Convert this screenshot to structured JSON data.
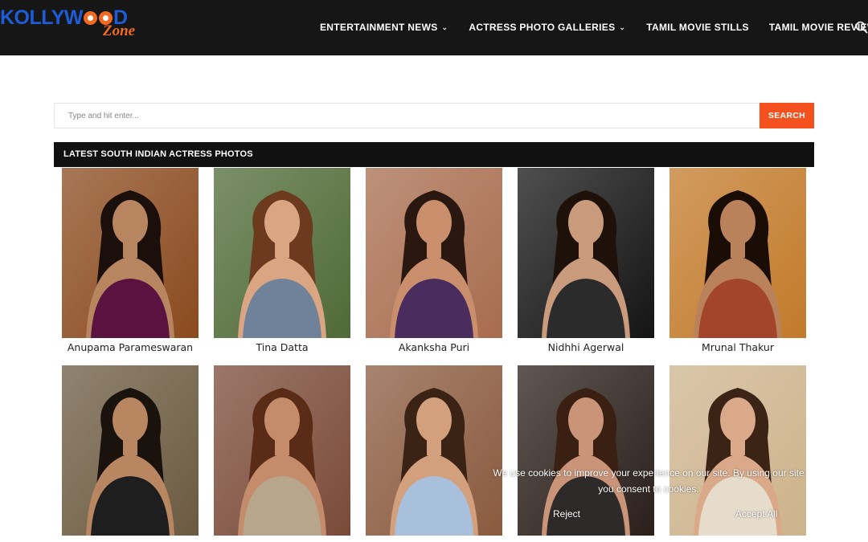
{
  "header": {
    "logo_main_a": "KOLLYW",
    "logo_main_b": "D",
    "logo_sub": "Zone",
    "nav": [
      {
        "label": "ENTERTAINMENT NEWS",
        "has_dropdown": true
      },
      {
        "label": "ACTRESS PHOTO GALLERIES",
        "has_dropdown": true
      },
      {
        "label": "TAMIL MOVIE STILLS",
        "has_dropdown": false
      },
      {
        "label": "TAMIL MOVIE REVIEWS",
        "has_dropdown": false
      }
    ],
    "search_icon": "search-icon"
  },
  "search": {
    "placeholder": "Type and hit enter...",
    "button_label": "SEARCH"
  },
  "section": {
    "title": "LATEST SOUTH INDIAN ACTRESS PHOTOS"
  },
  "gallery": [
    {
      "name": "Anupama Parameswaran",
      "bg": "#8a4a1e",
      "outfit": "#5a1240",
      "hair": "#1a0f0a",
      "skin": "#b7855f"
    },
    {
      "name": "Tina Datta",
      "bg": "#4f6a36",
      "outfit": "#6f8299",
      "hair": "#6b3a1f",
      "skin": "#d9a582"
    },
    {
      "name": "Akanksha Puri",
      "bg": "#a86c4e",
      "outfit": "#4a2d5e",
      "hair": "#2a1810",
      "skin": "#c98e6c"
    },
    {
      "name": "Nidhhi Agerwal",
      "bg": "#141414",
      "outfit": "#2b2b2b",
      "hair": "#1d1109",
      "skin": "#c99a7c"
    },
    {
      "name": "Mrunal Thakur",
      "bg": "#c27a2a",
      "outfit": "#a3452a",
      "hair": "#1a0d06",
      "skin": "#b9825b"
    },
    {
      "name": "",
      "bg": "#6b5a40",
      "outfit": "#1e1e1e",
      "hair": "#1a120c",
      "skin": "#b88660"
    },
    {
      "name": "",
      "bg": "#7a4a38",
      "outfit": "#b7a58c",
      "hair": "#5a2c18",
      "skin": "#c48c6a"
    },
    {
      "name": "",
      "bg": "#8a5a3e",
      "outfit": "#a8c0dc",
      "hair": "#3a2214",
      "skin": "#d3a07e"
    },
    {
      "name": "",
      "bg": "#2a1f1a",
      "outfit": "#2e2a2a",
      "hair": "#3a2012",
      "skin": "#c99478"
    },
    {
      "name": "",
      "bg": "#cdb38c",
      "outfit": "#e6dccb",
      "hair": "#3b2416",
      "skin": "#d9a989"
    }
  ],
  "cookie": {
    "line1": "We use cookies to improve your experience on our site. By using our site",
    "line2": "you consent to cookies.",
    "reject_label": "Reject",
    "accept_label": "Accept All"
  }
}
